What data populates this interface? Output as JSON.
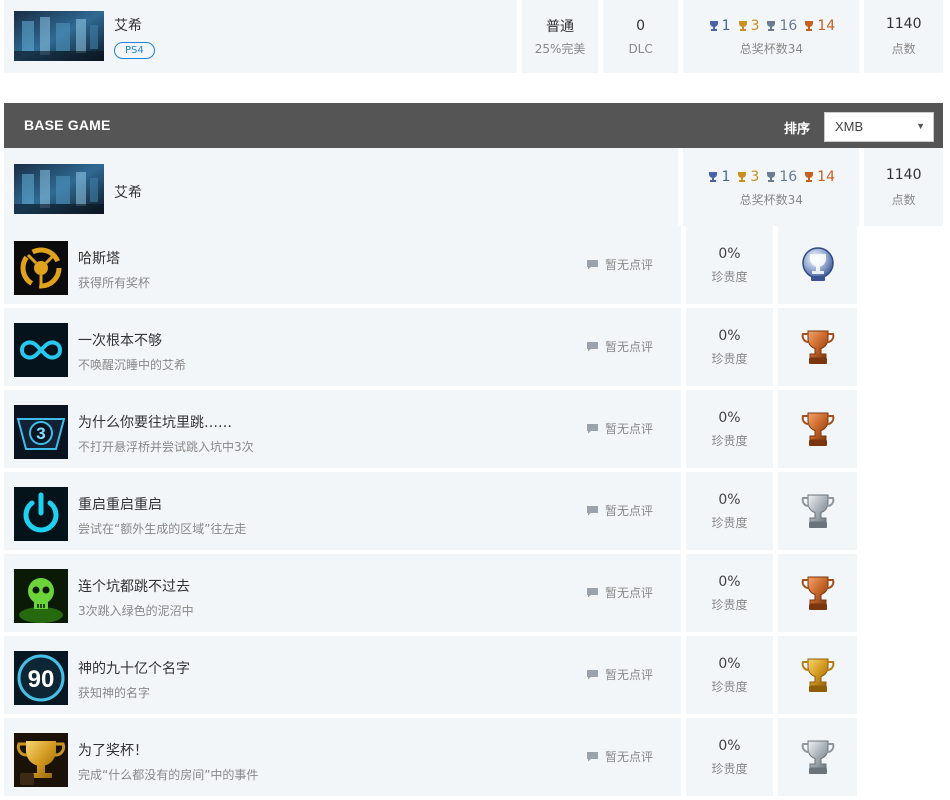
{
  "top": {
    "game_name": "艾希",
    "platform": "PS4",
    "difficulty_value": "普通",
    "difficulty_label": "25%完美",
    "dlc_value": "0",
    "dlc_label": "DLC",
    "trophies": {
      "platinum": "1",
      "gold": "3",
      "silver": "16",
      "bronze": "14"
    },
    "trophies_label": "总奖杯数34",
    "points_value": "1140",
    "points_label": "点数"
  },
  "section": {
    "title": "BASE GAME",
    "sort_label": "排序",
    "sort_selected": "XMB"
  },
  "subgame": {
    "name": "艾希",
    "trophies": {
      "platinum": "1",
      "gold": "3",
      "silver": "16",
      "bronze": "14"
    },
    "trophies_label": "总奖杯数34",
    "points_value": "1140",
    "points_label": "点数"
  },
  "colors": {
    "platinum": "#4a63a8",
    "gold": "#c9901e",
    "silver": "#6a7d8e",
    "bronze": "#c6611f",
    "header_bg": "#555555",
    "row_bg": "#f3f6f9"
  },
  "rows": [
    {
      "title": "哈斯塔",
      "desc": "获得所有奖杯",
      "comment": "暂无点评",
      "rarity": "0%",
      "rarity_label": "珍贵度",
      "type": "platinum",
      "icon": "hastur-icon"
    },
    {
      "title": "一次根本不够",
      "desc": "不唤醒沉睡中的艾希",
      "comment": "暂无点评",
      "rarity": "0%",
      "rarity_label": "珍贵度",
      "type": "bronze",
      "icon": "infinity-icon"
    },
    {
      "title": "为什么你要往坑里跳……",
      "desc": "不打开悬浮桥并尝试跳入坑中3次",
      "comment": "暂无点评",
      "rarity": "0%",
      "rarity_label": "珍贵度",
      "type": "bronze",
      "icon": "pit-three-icon"
    },
    {
      "title": "重启重启重启",
      "desc": "尝试在“额外生成的区域”往左走",
      "comment": "暂无点评",
      "rarity": "0%",
      "rarity_label": "珍贵度",
      "type": "silver",
      "icon": "power-icon"
    },
    {
      "title": "连个坑都跳不过去",
      "desc": "3次跳入绿色的泥沼中",
      "comment": "暂无点评",
      "rarity": "0%",
      "rarity_label": "珍贵度",
      "type": "bronze",
      "icon": "green-skull-icon"
    },
    {
      "title": "神的九十亿个名字",
      "desc": "获知神的名字",
      "comment": "暂无点评",
      "rarity": "0%",
      "rarity_label": "珍贵度",
      "type": "gold",
      "icon": "ninety-icon"
    },
    {
      "title": "为了奖杯！",
      "desc": "完成“什么都没有的房间”中的事件",
      "comment": "暂无点评",
      "rarity": "0%",
      "rarity_label": "珍贵度",
      "type": "silver",
      "icon": "golden-cup-icon"
    }
  ]
}
